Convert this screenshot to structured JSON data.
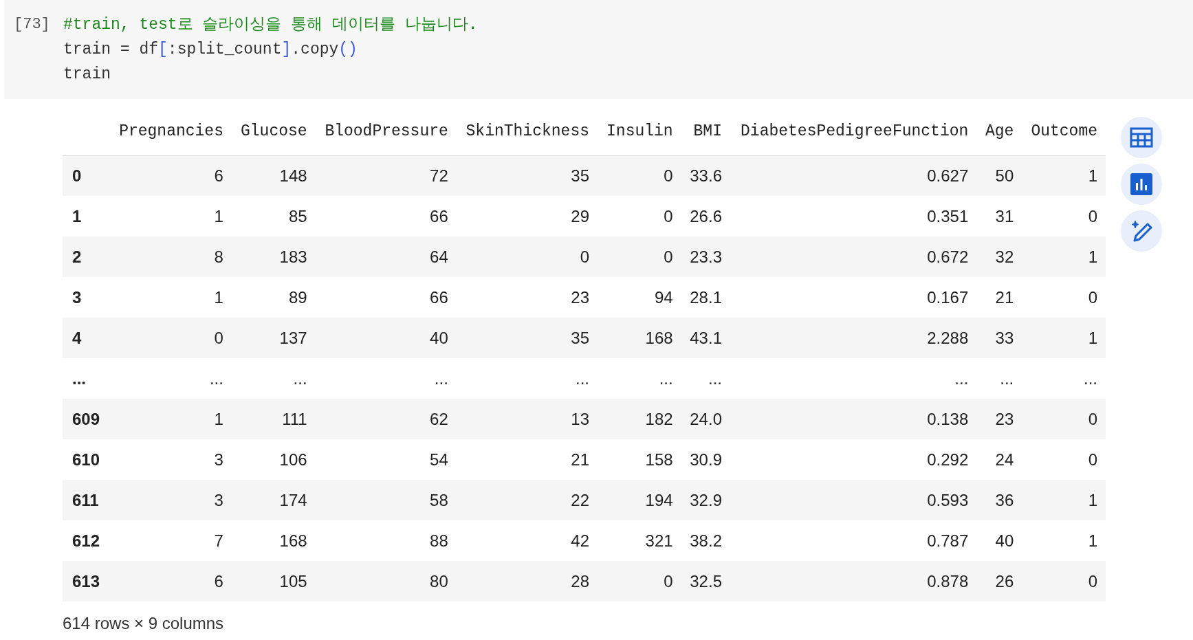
{
  "cell": {
    "execution_count": "[73]",
    "lines": [
      [
        {
          "kind": "comment",
          "text": "#train, test로 슬라이싱을 통해 데이터를 나눕니다."
        }
      ],
      [
        {
          "kind": "plain",
          "text": "train = df"
        },
        {
          "kind": "bracket",
          "text": "["
        },
        {
          "kind": "plain",
          "text": ":split_count"
        },
        {
          "kind": "bracket",
          "text": "]"
        },
        {
          "kind": "plain",
          "text": ".copy"
        },
        {
          "kind": "bracket",
          "text": "()"
        }
      ],
      [
        {
          "kind": "plain",
          "text": "train"
        }
      ]
    ]
  },
  "table": {
    "columns": [
      "",
      "Pregnancies",
      "Glucose",
      "BloodPressure",
      "SkinThickness",
      "Insulin",
      "BMI",
      "DiabetesPedigreeFunction",
      "Age",
      "Outcome"
    ],
    "rows": [
      [
        "0",
        "6",
        "148",
        "72",
        "35",
        "0",
        "33.6",
        "0.627",
        "50",
        "1"
      ],
      [
        "1",
        "1",
        "85",
        "66",
        "29",
        "0",
        "26.6",
        "0.351",
        "31",
        "0"
      ],
      [
        "2",
        "8",
        "183",
        "64",
        "0",
        "0",
        "23.3",
        "0.672",
        "32",
        "1"
      ],
      [
        "3",
        "1",
        "89",
        "66",
        "23",
        "94",
        "28.1",
        "0.167",
        "21",
        "0"
      ],
      [
        "4",
        "0",
        "137",
        "40",
        "35",
        "168",
        "43.1",
        "2.288",
        "33",
        "1"
      ],
      [
        "...",
        "...",
        "...",
        "...",
        "...",
        "...",
        "...",
        "...",
        "...",
        "..."
      ],
      [
        "609",
        "1",
        "111",
        "62",
        "13",
        "182",
        "24.0",
        "0.138",
        "23",
        "0"
      ],
      [
        "610",
        "3",
        "106",
        "54",
        "21",
        "158",
        "30.9",
        "0.292",
        "24",
        "0"
      ],
      [
        "611",
        "3",
        "174",
        "58",
        "22",
        "194",
        "32.9",
        "0.593",
        "36",
        "1"
      ],
      [
        "612",
        "7",
        "168",
        "88",
        "42",
        "321",
        "38.2",
        "0.787",
        "40",
        "1"
      ],
      [
        "613",
        "6",
        "105",
        "80",
        "28",
        "0",
        "32.5",
        "0.878",
        "26",
        "0"
      ]
    ],
    "footer": "614 rows × 9 columns"
  }
}
